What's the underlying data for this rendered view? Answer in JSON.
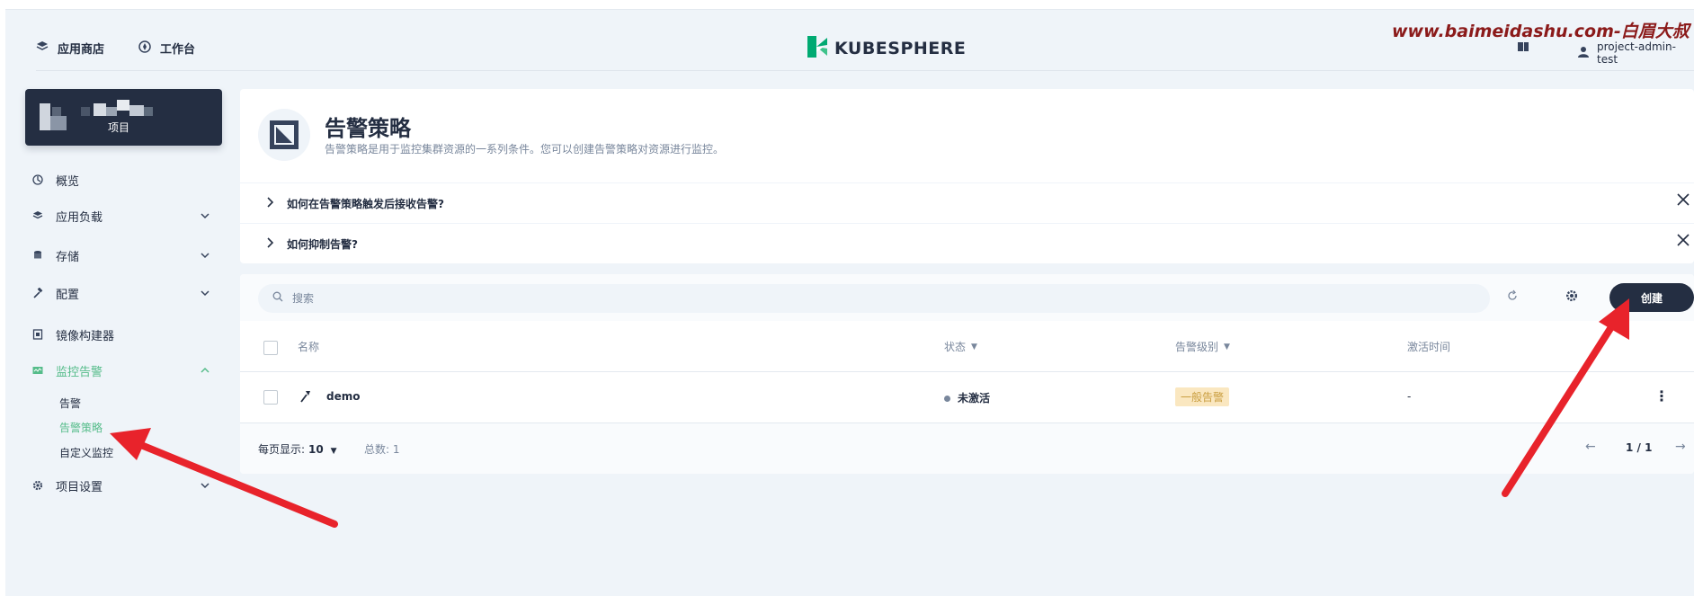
{
  "header": {
    "nav": [
      {
        "label": "应用商店",
        "icon": "stack-icon"
      },
      {
        "label": "工作台",
        "icon": "compass-icon"
      }
    ],
    "logo_text": "KUBESPHERE",
    "watermark": "www.baimeidashu.com-白眉大叔",
    "user": "project-admin-test"
  },
  "project": {
    "type_label": "项目"
  },
  "sidebar": {
    "items": [
      {
        "label": "概览",
        "icon": "dashboard-icon",
        "expandable": false
      },
      {
        "label": "应用负载",
        "icon": "stack-icon",
        "expandable": true
      },
      {
        "label": "存储",
        "icon": "storage-icon",
        "expandable": true
      },
      {
        "label": "配置",
        "icon": "hammer-icon",
        "expandable": true
      },
      {
        "label": "镜像构建器",
        "icon": "image-builder-icon",
        "expandable": false
      },
      {
        "label": "监控告警",
        "icon": "monitor-icon",
        "expandable": true,
        "expanded": true,
        "active": true
      },
      {
        "label": "项目设置",
        "icon": "gear-icon",
        "expandable": true
      }
    ],
    "sub_items": [
      {
        "label": "告警",
        "active": false
      },
      {
        "label": "告警策略",
        "active": true
      },
      {
        "label": "自定义监控",
        "active": false
      }
    ]
  },
  "page": {
    "title": "告警策略",
    "description": "告警策略是用于监控集群资源的一系列条件。您可以创建告警策略对资源进行监控。"
  },
  "faq": [
    {
      "question": "如何在告警策略触发后接收告警?"
    },
    {
      "question": "如何抑制告警?"
    }
  ],
  "toolbar": {
    "search_placeholder": "搜索",
    "create_label": "创建"
  },
  "table": {
    "columns": [
      "名称",
      "状态",
      "告警级别",
      "激活时间"
    ],
    "rows": [
      {
        "name": "demo",
        "status": "未激活",
        "level": "一般告警",
        "activated": "-"
      }
    ]
  },
  "pagination": {
    "per_page_label": "每页显示:",
    "per_page": "10",
    "total_label": "总数:",
    "total": "1",
    "page": "1 / 1"
  },
  "colors": {
    "accent": "#55bc8a",
    "dark": "#242e42",
    "badge_bg": "#fae7c0",
    "arrow": "#e8232b"
  }
}
